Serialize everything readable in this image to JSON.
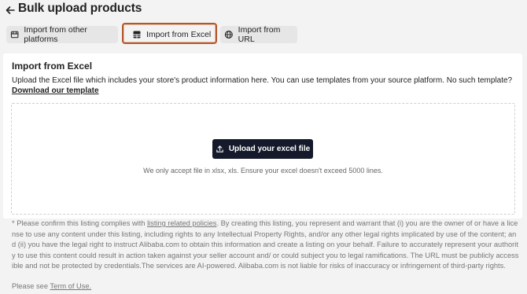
{
  "header": {
    "title": "Bulk upload products",
    "back_icon": "arrow-left-icon"
  },
  "tabs": [
    {
      "label": "Import from other platforms",
      "icon": "import-icon",
      "selected": false
    },
    {
      "label": "Import from Excel",
      "icon": "excel-sheet-icon",
      "selected": true
    },
    {
      "label": "Import from URL",
      "icon": "globe-icon",
      "selected": false
    }
  ],
  "card": {
    "title": "Import from Excel",
    "description": "Upload the Excel file which includes your store's product information here. You can use templates from your source platform. No such template?",
    "download_link": "Download our template",
    "upload_button": "Upload your excel file",
    "upload_icon": "upload-icon",
    "accept_note": "We only accept file in xlsx, xls. Ensure your excel doesn't exceed 5000 lines."
  },
  "disclaimer": {
    "prefix": "* Please confirm this listing complies with ",
    "policy_link": "listing related policies",
    "body": ". By creating this listing, you represent and warrant that (i) you are the owner of or have a license to use any content under this listing, including rights to any Intellectual Property Rights, and/or any other legal rights implicated by use of the content; and (ii) you have the legal right to instruct Alibaba.com to obtain this information and create a listing on your behalf. Failure to accurately represent your authority to use this content could result in action taken against your seller account and/ or could subject you to legal ramifications. The URL must be publicly accessible and not be protected by credentials.The services are AI-powered. Alibaba.com is not liable for risks of inaccuracy or infringement of third-party rights.",
    "see_prefix": "Please see ",
    "terms_link": "Term of Use."
  },
  "colors": {
    "accent_outline": "#b2572a",
    "primary_button": "#141a2b",
    "background": "#f3f3f3"
  }
}
